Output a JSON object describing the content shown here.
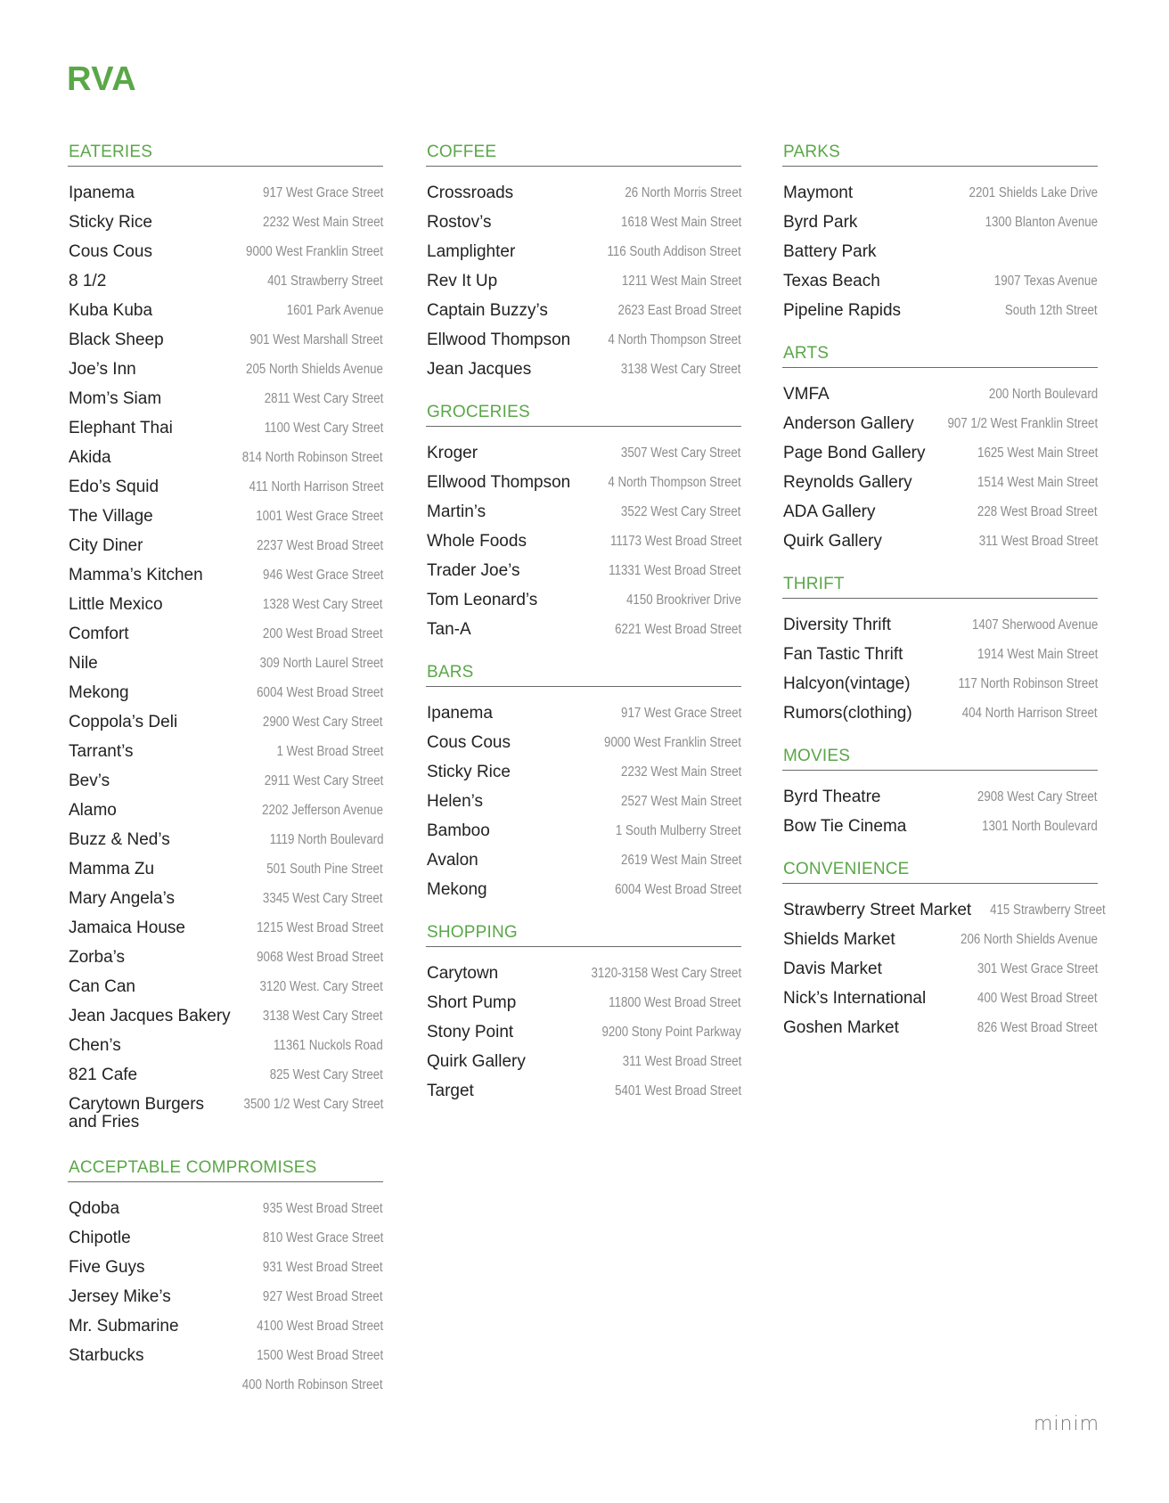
{
  "title": "RVA",
  "brand": "minim",
  "accent_color": "#5aa748",
  "columns": [
    [
      {
        "heading": "EATERIES",
        "items": [
          {
            "name": "Ipanema",
            "address": "917 West Grace Street"
          },
          {
            "name": "Sticky Rice",
            "address": "2232 West Main Street"
          },
          {
            "name": "Cous Cous",
            "address": "9000 West Franklin Street"
          },
          {
            "name": "8 1/2",
            "address": "401 Strawberry Street"
          },
          {
            "name": "Kuba Kuba",
            "address": "1601 Park Avenue"
          },
          {
            "name": "Black Sheep",
            "address": "901 West Marshall Street"
          },
          {
            "name": "Joe’s Inn",
            "address": "205 North Shields Avenue"
          },
          {
            "name": "Mom’s Siam",
            "address": "2811 West Cary Street"
          },
          {
            "name": "Elephant Thai",
            "address": "1100 West Cary Street"
          },
          {
            "name": "Akida",
            "address": "814 North Robinson Street"
          },
          {
            "name": "Edo’s Squid",
            "address": "411 North Harrison Street"
          },
          {
            "name": "The Village",
            "address": "1001 West Grace Street"
          },
          {
            "name": "City Diner",
            "address": "2237 West Broad Street"
          },
          {
            "name": "Mamma’s Kitchen",
            "address": "946 West Grace Street"
          },
          {
            "name": "Little Mexico",
            "address": "1328 West Cary Street"
          },
          {
            "name": "Comfort",
            "address": "200 West Broad Street"
          },
          {
            "name": "Nile",
            "address": "309 North Laurel Street"
          },
          {
            "name": "Mekong",
            "address": "6004 West Broad Street"
          },
          {
            "name": "Coppola’s Deli",
            "address": "2900 West Cary Street"
          },
          {
            "name": "Tarrant’s",
            "address": "1 West Broad Street"
          },
          {
            "name": "Bev’s",
            "address": "2911 West Cary Street"
          },
          {
            "name": "Alamo",
            "address": "2202 Jefferson Avenue"
          },
          {
            "name": "Buzz & Ned’s",
            "address": "1119 North Boulevard"
          },
          {
            "name": "Mamma Zu",
            "address": "501 South Pine Street"
          },
          {
            "name": "Mary Angela’s",
            "address": "3345 West Cary Street"
          },
          {
            "name": "Jamaica House",
            "address": "1215 West Broad Street"
          },
          {
            "name": "Zorba’s",
            "address": "9068 West Broad Street"
          },
          {
            "name": "Can Can",
            "address": "3120 West. Cary Street"
          },
          {
            "name": "Jean Jacques Bakery",
            "address": "3138 West Cary Street"
          },
          {
            "name": "Chen’s",
            "address": "11361 Nuckols Road"
          },
          {
            "name": "821 Cafe",
            "address": "825 West Cary Street"
          },
          {
            "name": "Carytown Burgers and Fries",
            "address": "3500 1/2 West Cary Street"
          }
        ]
      },
      {
        "heading": "ACCEPTABLE COMPROMISES",
        "items": [
          {
            "name": "Qdoba",
            "address": "935 West Broad Street"
          },
          {
            "name": "Chipotle",
            "address": "810 West Grace Street"
          },
          {
            "name": "Five Guys",
            "address": "931 West Broad Street"
          },
          {
            "name": "Jersey Mike’s",
            "address": "927 West Broad Street"
          },
          {
            "name": "Mr. Submarine",
            "address": "4100 West Broad Street"
          },
          {
            "name": "Starbucks",
            "address": "1500 West Broad Street"
          },
          {
            "name": "",
            "address": "400 North Robinson Street"
          }
        ]
      }
    ],
    [
      {
        "heading": "COFFEE",
        "items": [
          {
            "name": "Crossroads",
            "address": "26 North Morris Street"
          },
          {
            "name": "Rostov’s",
            "address": "1618 West Main Street"
          },
          {
            "name": "Lamplighter",
            "address": "116 South Addison Street"
          },
          {
            "name": "Rev It Up",
            "address": "1211 West Main Street"
          },
          {
            "name": "Captain Buzzy’s",
            "address": "2623 East Broad Street"
          },
          {
            "name": "Ellwood Thompson",
            "address": "4 North Thompson Street"
          },
          {
            "name": "Jean Jacques",
            "address": "3138 West Cary Street"
          }
        ]
      },
      {
        "heading": "GROCERIES",
        "items": [
          {
            "name": "Kroger",
            "address": "3507 West Cary Street"
          },
          {
            "name": "Ellwood Thompson",
            "address": "4 North Thompson Street"
          },
          {
            "name": "Martin’s",
            "address": "3522 West Cary Street"
          },
          {
            "name": "Whole Foods",
            "address": "11173 West Broad Street"
          },
          {
            "name": "Trader Joe’s",
            "address": "11331 West Broad Street"
          },
          {
            "name": "Tom Leonard’s",
            "address": "4150 Brookriver Drive"
          },
          {
            "name": "Tan-A",
            "address": "6221 West Broad Street"
          }
        ]
      },
      {
        "heading": "BARS",
        "items": [
          {
            "name": "Ipanema",
            "address": "917 West Grace Street"
          },
          {
            "name": "Cous Cous",
            "address": "9000 West Franklin Street"
          },
          {
            "name": "Sticky Rice",
            "address": "2232 West Main Street"
          },
          {
            "name": "Helen’s",
            "address": "2527 West Main Street"
          },
          {
            "name": "Bamboo",
            "address": "1 South Mulberry Street"
          },
          {
            "name": "Avalon",
            "address": "2619 West Main Street"
          },
          {
            "name": "Mekong",
            "address": "6004 West Broad Street"
          }
        ]
      },
      {
        "heading": "SHOPPING",
        "items": [
          {
            "name": "Carytown",
            "address": "3120-3158 West Cary Street"
          },
          {
            "name": "Short Pump",
            "address": "11800 West Broad Street"
          },
          {
            "name": "Stony Point",
            "address": "9200 Stony Point Parkway"
          },
          {
            "name": "Quirk Gallery",
            "address": "311 West Broad Street"
          },
          {
            "name": "Target",
            "address": "5401 West Broad Street"
          }
        ]
      }
    ],
    [
      {
        "heading": "PARKS",
        "items": [
          {
            "name": "Maymont",
            "address": "2201 Shields Lake Drive"
          },
          {
            "name": "Byrd Park",
            "address": "1300 Blanton Avenue"
          },
          {
            "name": "Battery Park",
            "address": ""
          },
          {
            "name": "Texas Beach",
            "address": "1907 Texas Avenue"
          },
          {
            "name": "Pipeline Rapids",
            "address": "South 12th Street"
          }
        ]
      },
      {
        "heading": "ARTS",
        "items": [
          {
            "name": "VMFA",
            "address": "200 North Boulevard"
          },
          {
            "name": "Anderson Gallery",
            "address": "907 1/2 West Franklin Street"
          },
          {
            "name": "Page Bond Gallery",
            "address": "1625 West Main Street"
          },
          {
            "name": "Reynolds Gallery",
            "address": "1514 West Main Street"
          },
          {
            "name": "ADA Gallery",
            "address": "228 West Broad Street"
          },
          {
            "name": "Quirk Gallery",
            "address": "311 West Broad Street"
          }
        ]
      },
      {
        "heading": "THRIFT",
        "items": [
          {
            "name": "Diversity Thrift",
            "address": "1407 Sherwood Avenue"
          },
          {
            "name": "Fan Tastic Thrift",
            "address": "1914 West Main Street"
          },
          {
            "name": "Halcyon(vintage)",
            "address": "117 North Robinson Street"
          },
          {
            "name": "Rumors(clothing)",
            "address": "404 North Harrison Street"
          }
        ]
      },
      {
        "heading": "MOVIES",
        "items": [
          {
            "name": "Byrd Theatre",
            "address": "2908 West Cary Street"
          },
          {
            "name": "Bow Tie Cinema",
            "address": "1301 North Boulevard"
          }
        ]
      },
      {
        "heading": "CONVENIENCE",
        "items": [
          {
            "name": "Strawberry Street Market",
            "address": "415 Strawberry Street"
          },
          {
            "name": "Shields Market",
            "address": "206 North Shields Avenue"
          },
          {
            "name": "Davis Market",
            "address": "301 West Grace Street"
          },
          {
            "name": "Nick’s International",
            "address": "400 West Broad Street"
          },
          {
            "name": "Goshen Market",
            "address": "826 West Broad Street"
          }
        ]
      }
    ]
  ]
}
